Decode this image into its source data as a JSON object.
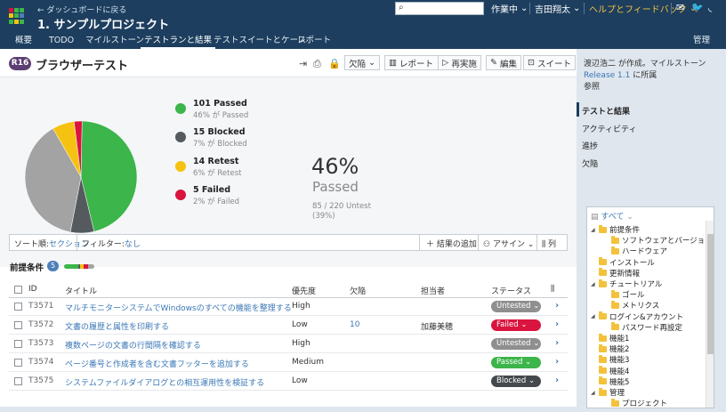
{
  "colors": {
    "passed": "#3cb54a",
    "blocked": "#555a5f",
    "retest": "#f5c211",
    "failed": "#d9143e",
    "untested": "#a3a3a3"
  },
  "header": {
    "back_link": "← ダッシュボードに戻る",
    "project": "1. サンプルプロジェクト",
    "search_value": "",
    "menu_work": "作業中",
    "menu_user": "吉田翔太",
    "menu_help": "ヘルプとフィードバック",
    "icons": [
      "mail-icon",
      "twitter-icon",
      "rss-icon"
    ]
  },
  "nav": {
    "tabs": [
      "概要",
      "TODO",
      "マイルストーン",
      "テストランと結果",
      "テストスイートとケース",
      "レポート"
    ],
    "admin": "管理"
  },
  "run": {
    "badge": "R16",
    "title": "ブラウザーテスト",
    "btn_defect": "欠陥",
    "btn_report": "レポート",
    "btn_rerun": "再実施",
    "btn_edit": "編集",
    "btn_suite": "スイート"
  },
  "chart_data": {
    "type": "pie",
    "slices": [
      {
        "label": "Passed",
        "value": 101,
        "color": "#3cb54a"
      },
      {
        "label": "Blocked",
        "value": 15,
        "color": "#555a5f"
      },
      {
        "label": "Untested",
        "value": 85,
        "color": "#a3a3a3"
      },
      {
        "label": "Retest",
        "value": 14,
        "color": "#f5c211"
      },
      {
        "label": "Failed",
        "value": 5,
        "color": "#d9143e"
      }
    ]
  },
  "legend": [
    {
      "main": "101 Passed",
      "sub": "46% が Passed"
    },
    {
      "main": "15 Blocked",
      "sub": "7% が Blocked"
    },
    {
      "main": "14 Retest",
      "sub": "6% が Retest"
    },
    {
      "main": "5 Failed",
      "sub": "2% が Failed"
    }
  ],
  "summary": {
    "pct": "46%",
    "label": "Passed",
    "untested_line1": "85 / 220 Untest",
    "untested_line2": "(39%)"
  },
  "toolbar": {
    "sort_label": "ソート順:",
    "sort_value": "セクション",
    "filter_label": "フィルター:",
    "filter_value": "なし",
    "add_result": "結果の追加",
    "assign": "アサイン",
    "columns": "列"
  },
  "section": {
    "title": "前提条件",
    "count": "5"
  },
  "table": {
    "columns": [
      "ID",
      "タイトル",
      "優先度",
      "欠陥",
      "担当者",
      "ステータス"
    ],
    "rows": [
      {
        "id": "T3571",
        "title": "マルチモニターシステムでWindowsのすべての機能を整理する",
        "priority": "High",
        "defect": "",
        "assignee": "",
        "status": "Untested",
        "status_color": "#8f8f8f"
      },
      {
        "id": "T3572",
        "title": "文書の履歴と属性を印刷する",
        "priority": "Low",
        "defect": "10",
        "assignee": "加藤美穂",
        "status": "Failed",
        "status_color": "#d9143e"
      },
      {
        "id": "T3573",
        "title": "複数ページの文書の行間隔を確認する",
        "priority": "High",
        "defect": "",
        "assignee": "",
        "status": "Untested",
        "status_color": "#8f8f8f"
      },
      {
        "id": "T3574",
        "title": "ページ番号と作成者を含む文書フッターを追加する",
        "priority": "Medium",
        "defect": "",
        "assignee": "",
        "status": "Passed",
        "status_color": "#3cb54a"
      },
      {
        "id": "T3575",
        "title": "システムファイルダイアログとの相互運用性を検証する",
        "priority": "Low",
        "defect": "",
        "assignee": "",
        "status": "Blocked",
        "status_color": "#45494d"
      }
    ]
  },
  "right": {
    "info_prefix": "渡辺浩二 が作成。マイルストーン",
    "info_link": "Release 1.1",
    "info_suffix": " に所属",
    "info_ref": "参照",
    "nav": [
      "テストと結果",
      "アクティビティ",
      "進捗",
      "欠陥"
    ],
    "tree_all": "すべて",
    "tree": [
      {
        "label": "前提条件",
        "level": 0,
        "expanded": true
      },
      {
        "label": "ソフトウェアとバージョン",
        "level": 1
      },
      {
        "label": "ハードウェア",
        "level": 1
      },
      {
        "label": "インストール",
        "level": 0
      },
      {
        "label": "更新情報",
        "level": 0
      },
      {
        "label": "チュートリアル",
        "level": 0,
        "expanded": true
      },
      {
        "label": "ゴール",
        "level": 1
      },
      {
        "label": "メトリクス",
        "level": 1
      },
      {
        "label": "ログイン&アカウント",
        "level": 0,
        "expanded": true
      },
      {
        "label": "パスワード再設定",
        "level": 1
      },
      {
        "label": "機能1",
        "level": 0
      },
      {
        "label": "機能2",
        "level": 0
      },
      {
        "label": "機能3",
        "level": 0
      },
      {
        "label": "機能4",
        "level": 0
      },
      {
        "label": "機能5",
        "level": 0
      },
      {
        "label": "管理",
        "level": 0,
        "expanded": true
      },
      {
        "label": "プロジェクト",
        "level": 1
      }
    ]
  }
}
